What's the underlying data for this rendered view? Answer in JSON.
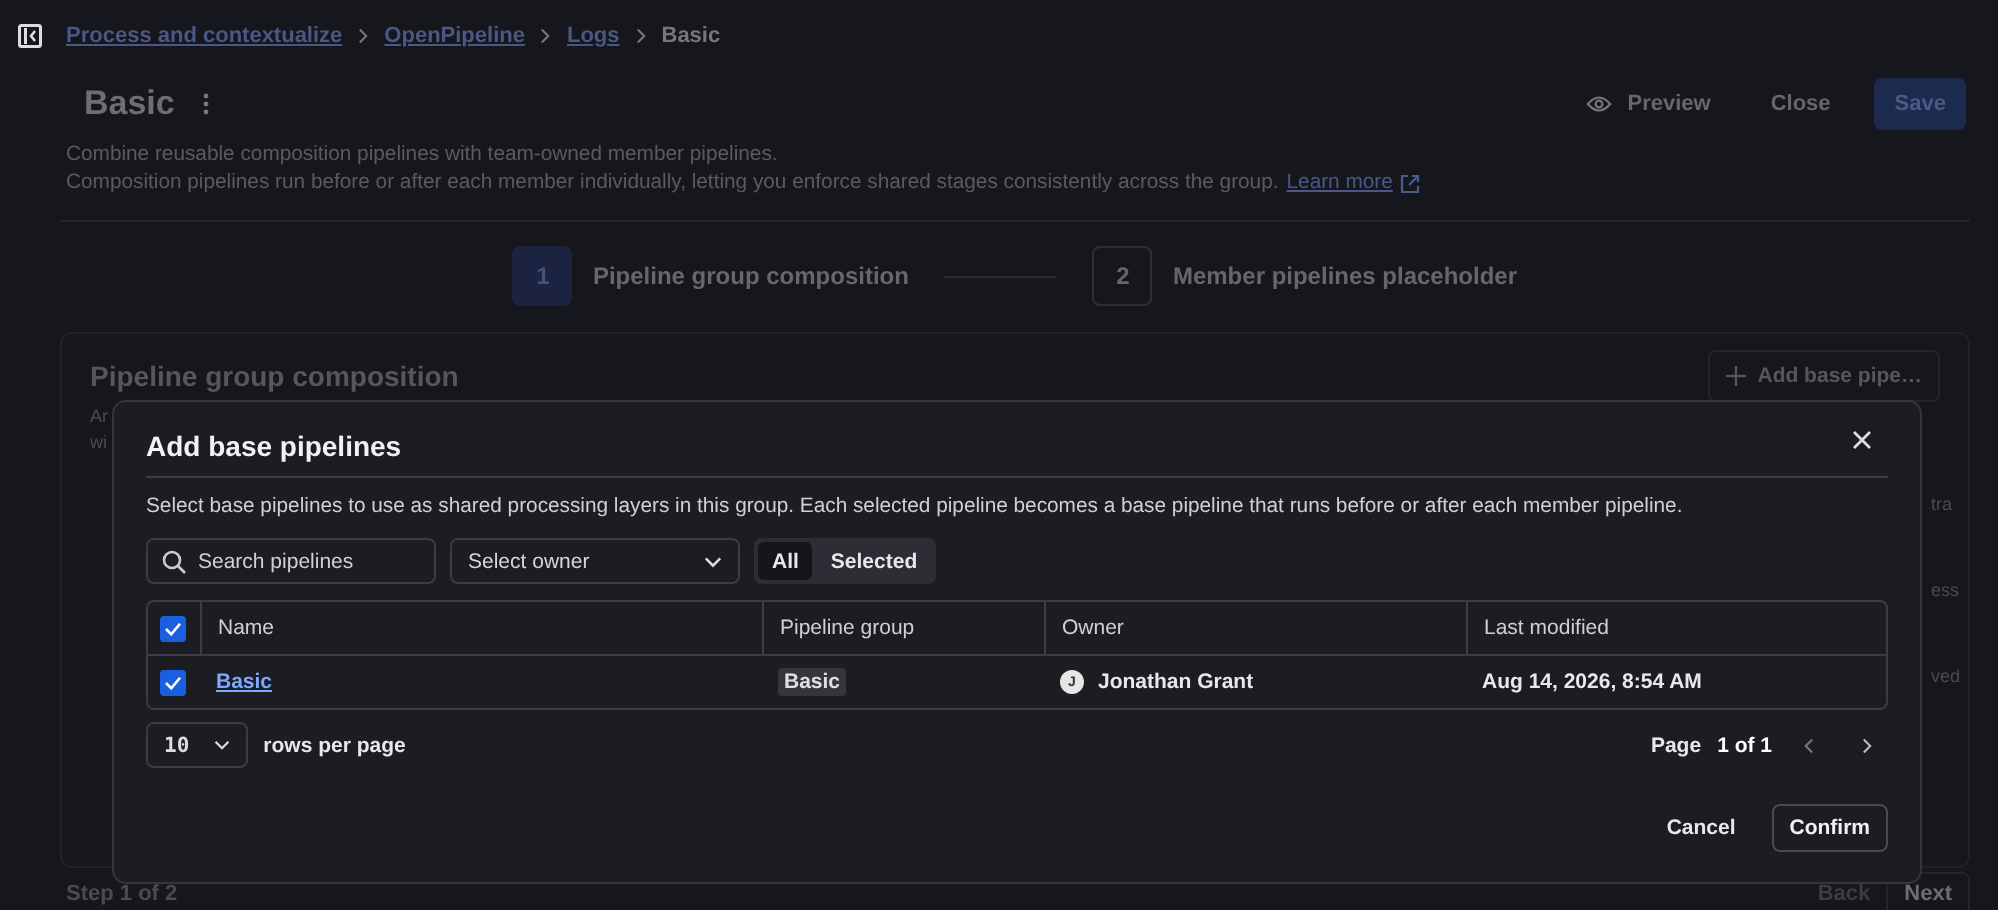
{
  "breadcrumb": [
    {
      "label": "Process and contextualize",
      "link": true
    },
    {
      "label": "OpenPipeline",
      "link": true
    },
    {
      "label": "Logs",
      "link": true
    },
    {
      "label": "Basic",
      "link": false
    }
  ],
  "page": {
    "title": "Basic",
    "actions": {
      "preview": "Preview",
      "close": "Close",
      "save": "Save"
    },
    "description": [
      "Combine reusable composition pipelines with team-owned member pipelines.",
      "Composition pipelines run before or after each member individually, letting you enforce shared stages consistently across the group."
    ],
    "learn_more": "Learn more"
  },
  "steps": [
    {
      "number": "1",
      "label": "Pipeline group composition",
      "selected": true
    },
    {
      "number": "2",
      "label": "Member pipelines placeholder",
      "selected": false
    }
  ],
  "card": {
    "title": "Pipeline group composition",
    "add_button": "Add base pipe…",
    "left_text": [
      "Ar",
      "wi"
    ],
    "right_text": [
      "tra",
      "ess",
      "ved"
    ]
  },
  "footer": {
    "step": "Step 1 of 2",
    "back": "Back",
    "next": "Next"
  },
  "dialog": {
    "title": "Add base pipelines",
    "description": "Select base pipelines to use as shared processing layers in this group. Each selected pipeline becomes a base pipeline that runs before or after each member pipeline.",
    "search": {
      "placeholder": "Search pipelines"
    },
    "owner_select": {
      "placeholder": "Select owner"
    },
    "filter": [
      {
        "label": "All",
        "selected": true
      },
      {
        "label": "Selected",
        "selected": false
      }
    ],
    "table": {
      "all_checked": true,
      "columns": [
        "Name",
        "Pipeline group",
        "Owner",
        "Last modified"
      ],
      "rows": [
        {
          "checked": true,
          "name": "Basic",
          "group": "Basic",
          "owner_initial": "J",
          "owner": "Jonathan Grant",
          "modified": "Aug 14, 2026, 8:54 AM"
        }
      ]
    },
    "pagination": {
      "page_size": "10",
      "rows_label": "rows per page",
      "page_label": "Page",
      "page_value": "1 of 1"
    },
    "buttons": {
      "cancel": "Cancel",
      "confirm": "Confirm"
    }
  }
}
